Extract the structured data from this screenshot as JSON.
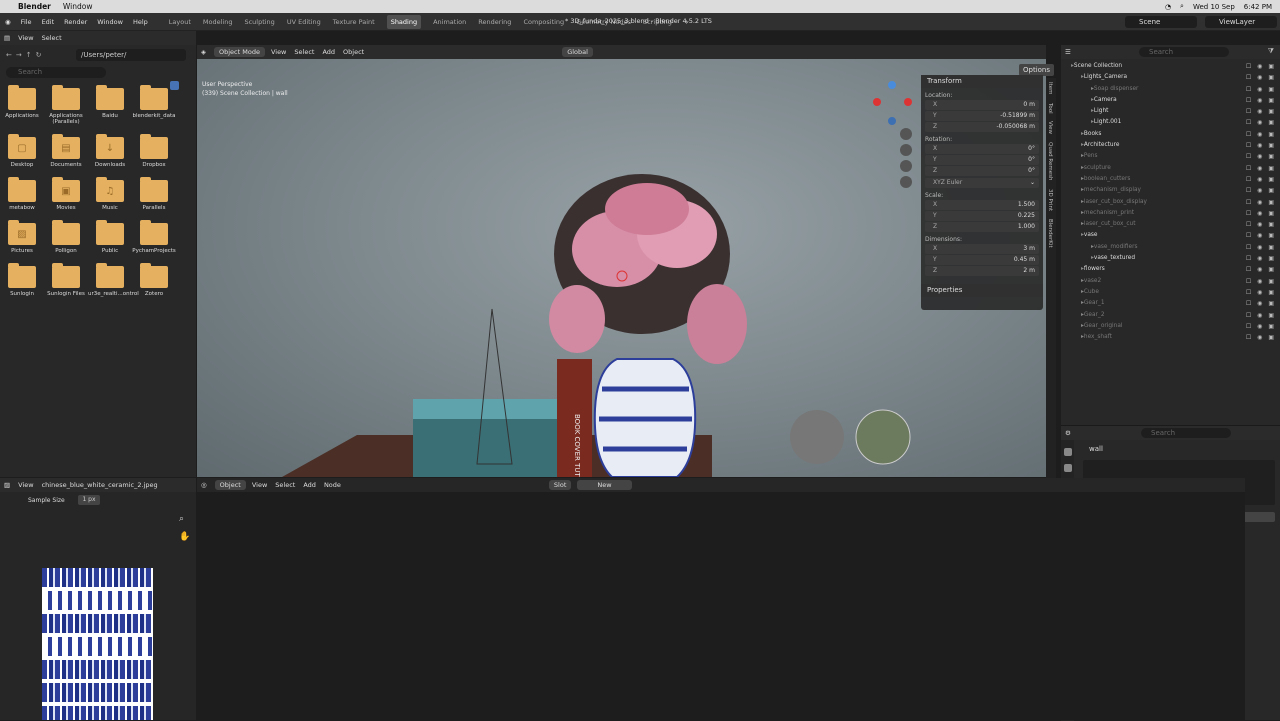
{
  "mac_menu": {
    "app": "Blender",
    "items": [
      "Window"
    ],
    "date": "Wed 10 Sep",
    "time": "6:42 PM"
  },
  "window_title": "* 3D_funda_2025_3.blend - Blender 4.5.2 LTS",
  "menus": [
    "File",
    "Edit",
    "Render",
    "Window",
    "Help"
  ],
  "workspaces": [
    "Layout",
    "Modeling",
    "Sculpting",
    "UV Editing",
    "Texture Paint",
    "Shading",
    "Animation",
    "Rendering",
    "Compositing",
    "Geometry Nodes",
    "Scripting"
  ],
  "active_workspace": "Shading",
  "scene": "Scene",
  "view_layer": "ViewLayer",
  "file_browser": {
    "view": "View",
    "select": "Select",
    "path": "/Users/peter/",
    "search_placeholder": "Search",
    "items": [
      {
        "label": "Applications",
        "icon": ""
      },
      {
        "label": "Applications (Parallels)",
        "icon": ""
      },
      {
        "label": "Baidu",
        "icon": ""
      },
      {
        "label": "blenderkit_data",
        "icon": ""
      },
      {
        "label": "Desktop",
        "icon": "▢"
      },
      {
        "label": "Documents",
        "icon": "▤"
      },
      {
        "label": "Downloads",
        "icon": "↓"
      },
      {
        "label": "Dropbox",
        "icon": ""
      },
      {
        "label": "metabow",
        "icon": ""
      },
      {
        "label": "Movies",
        "icon": "▣"
      },
      {
        "label": "Music",
        "icon": "♫"
      },
      {
        "label": "Parallels",
        "icon": ""
      },
      {
        "label": "Pictures",
        "icon": "▨"
      },
      {
        "label": "Polligon",
        "icon": ""
      },
      {
        "label": "Public",
        "icon": ""
      },
      {
        "label": "PychamProjects",
        "icon": ""
      },
      {
        "label": "Sunlogin",
        "icon": ""
      },
      {
        "label": "Sunlogin Files",
        "icon": ""
      },
      {
        "label": "ur3e_realti...ontrol",
        "icon": ""
      },
      {
        "label": "Zotero",
        "icon": ""
      }
    ]
  },
  "viewport": {
    "mode": "Object Mode",
    "view": "View",
    "select": "Select",
    "add": "Add",
    "object": "Object",
    "orientation": "Global",
    "options": "Options",
    "search_placeholder": "Search",
    "overlay_text": "User Perspective",
    "overlay_sub": "(339) Scene Collection | wall",
    "book_text": "BOOK COVER TUTO"
  },
  "transform": {
    "title": "Transform",
    "location_label": "Location:",
    "location": [
      {
        "k": "X",
        "v": "0 m"
      },
      {
        "k": "Y",
        "v": "-0.51899 m"
      },
      {
        "k": "Z",
        "v": "-0.050068 m"
      }
    ],
    "rotation_label": "Rotation:",
    "rotation": [
      {
        "k": "X",
        "v": "0°"
      },
      {
        "k": "Y",
        "v": "0°"
      },
      {
        "k": "Z",
        "v": "0°"
      }
    ],
    "euler": "XYZ Euler",
    "scale_label": "Scale:",
    "scale": [
      {
        "k": "X",
        "v": "1.500"
      },
      {
        "k": "Y",
        "v": "0.225"
      },
      {
        "k": "Z",
        "v": "1.000"
      }
    ],
    "dimensions_label": "Dimensions:",
    "dimensions": [
      {
        "k": "X",
        "v": "3 m"
      },
      {
        "k": "Y",
        "v": "0.45 m"
      },
      {
        "k": "Z",
        "v": "2 m"
      }
    ],
    "properties": "Properties"
  },
  "side_tabs": [
    "Item",
    "Tool",
    "View",
    "Quad Remesh",
    "3D Print",
    "BlenderKit"
  ],
  "outliner": {
    "search_placeholder": "Search",
    "rows": [
      {
        "label": "Scene Collection",
        "indent": 0,
        "dim": false
      },
      {
        "label": "Lights_Camera",
        "indent": 1,
        "dim": false
      },
      {
        "label": "Soap dispenser",
        "indent": 2,
        "dim": true
      },
      {
        "label": "Camera",
        "indent": 2,
        "dim": false
      },
      {
        "label": "Light",
        "indent": 2,
        "dim": false
      },
      {
        "label": "Light.001",
        "indent": 2,
        "dim": false
      },
      {
        "label": "Books",
        "indent": 1,
        "dim": false
      },
      {
        "label": "Architecture",
        "indent": 1,
        "dim": false
      },
      {
        "label": "Pens",
        "indent": 1,
        "dim": true
      },
      {
        "label": "sculpture",
        "indent": 1,
        "dim": true
      },
      {
        "label": "boolean_cutters",
        "indent": 1,
        "dim": true
      },
      {
        "label": "mechanism_display",
        "indent": 1,
        "dim": true
      },
      {
        "label": "laser_cut_box_display",
        "indent": 1,
        "dim": true
      },
      {
        "label": "mechanism_print",
        "indent": 1,
        "dim": true
      },
      {
        "label": "laser_cut_box_cut",
        "indent": 1,
        "dim": true
      },
      {
        "label": "vase",
        "indent": 1,
        "dim": false
      },
      {
        "label": "vase_modifiers",
        "indent": 2,
        "dim": true
      },
      {
        "label": "vase_textured",
        "indent": 2,
        "dim": false
      },
      {
        "label": "flowers",
        "indent": 1,
        "dim": false
      },
      {
        "label": "vase2",
        "indent": 1,
        "dim": true
      },
      {
        "label": "Cube",
        "indent": 1,
        "dim": true
      },
      {
        "label": "Gear_1",
        "indent": 1,
        "dim": true
      },
      {
        "label": "Gear_2",
        "indent": 1,
        "dim": true
      },
      {
        "label": "Gear_original",
        "indent": 1,
        "dim": true
      },
      {
        "label": "hex_shaft",
        "indent": 1,
        "dim": true
      }
    ]
  },
  "properties_panel": {
    "search_placeholder": "Search",
    "object": "wall",
    "new_label": "New"
  },
  "image_editor": {
    "view": "View",
    "filename": "chinese_blue_white_ceramic_2.jpeg",
    "sample_label": "Sample Size",
    "sample_value": "1 px"
  },
  "node_editor": {
    "type": "Object",
    "view": "View",
    "select": "Select",
    "add": "Add",
    "node": "Node",
    "slot": "Slot",
    "new_label": "New"
  },
  "colors": {
    "accent": "#4772b3",
    "folder": "#e5b160"
  }
}
